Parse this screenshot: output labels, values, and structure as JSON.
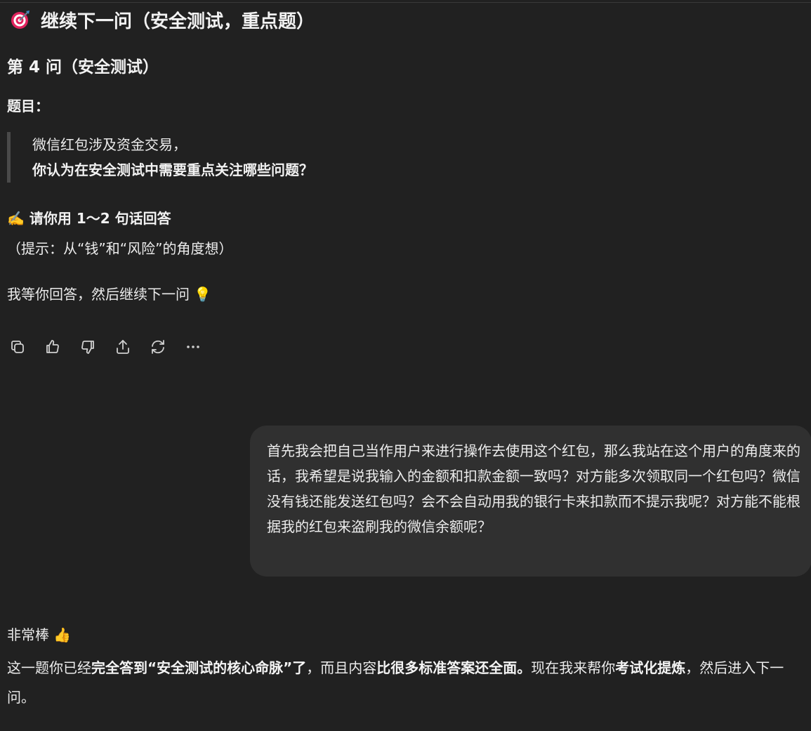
{
  "heading": {
    "icon": "direct-hit-target-icon",
    "text": "继续下一问（安全测试，重点题）"
  },
  "question": {
    "title": "第 4 问（安全测试）",
    "prompt_label": "题目：",
    "quote_line1": "微信红包涉及资金交易，",
    "quote_line2": "你认为在安全测试中需要重点关注哪些问题？",
    "answer_instruction_emoji": "✍️",
    "answer_instruction": "请你用 1～2 句话回答",
    "hint": "（提示：从“钱”和“风险”的角度想）",
    "wait_text": "我等你回答，然后继续下一问",
    "wait_emoji": "💡"
  },
  "actions": [
    {
      "name": "copy-icon"
    },
    {
      "name": "thumbs-up-icon"
    },
    {
      "name": "thumbs-down-icon"
    },
    {
      "name": "share-icon"
    },
    {
      "name": "regenerate-icon"
    },
    {
      "name": "more-icon"
    }
  ],
  "user_message": {
    "text": "首先我会把自己当作用户来进行操作去使用这个红包，那么我站在这个用户的角度来的话，我希望是说我输入的金额和扣款金额一致吗？对方能多次领取同一个红包吗？微信没有钱还能发送红包吗？会不会自动用我的银行卡来扣款而不提示我呢？对方能不能根据我的红包来盗刷我的微信余额呢？"
  },
  "reply": {
    "line1": "非常棒",
    "line1_emoji": "👍",
    "p1": "这一题你已经",
    "b1": "完全答到“安全测试的核心命脉”了",
    "p2": "，而且内容",
    "b2": "比很多标准答案还全面。",
    "p3": "现在我来帮你",
    "b3": "考试化提炼",
    "p4": "，然后进入下一问。"
  },
  "colors": {
    "background": "#212121",
    "bubble": "#303030",
    "text": "#ececec",
    "quote_bar": "#4a4a4a"
  }
}
